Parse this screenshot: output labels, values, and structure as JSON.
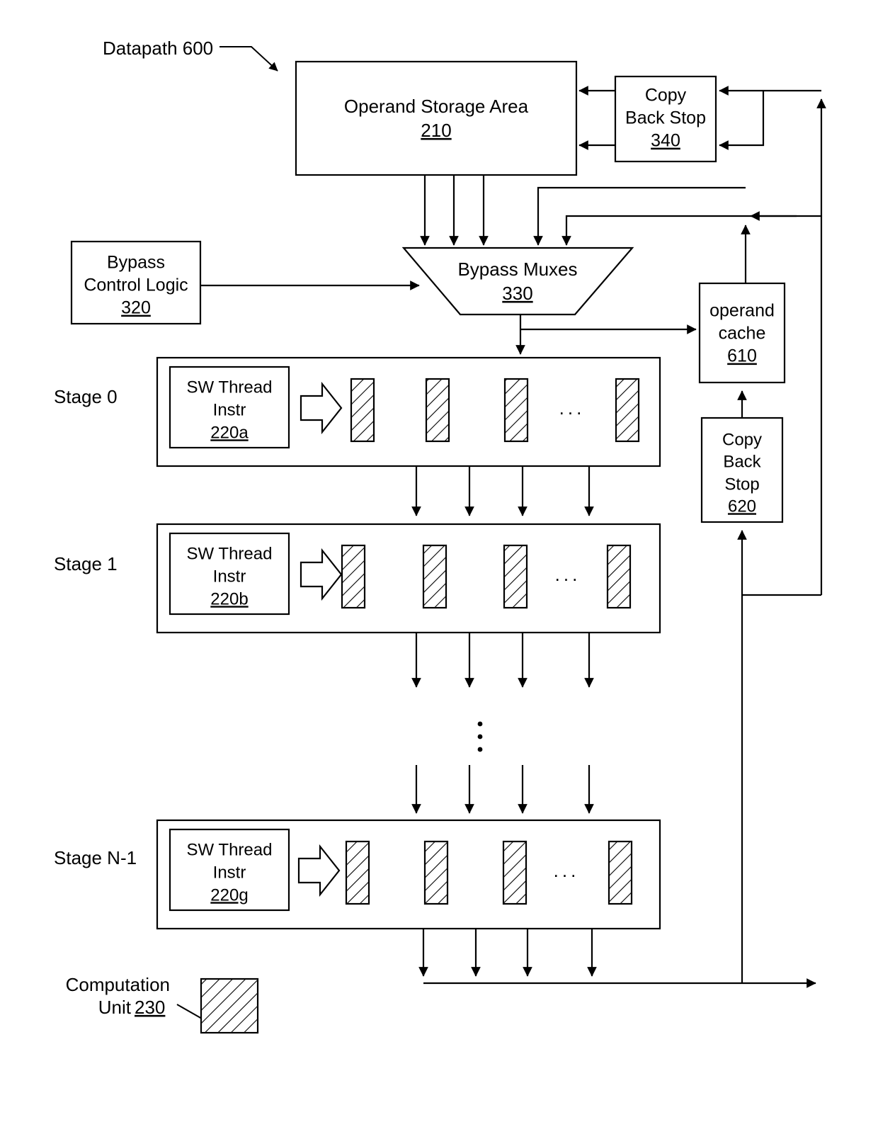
{
  "figure": {
    "title_label": "Datapath 600",
    "legend": {
      "line1": "Computation",
      "line2": "Unit",
      "number": "230"
    }
  },
  "blocks": {
    "operand_storage": {
      "label": "Operand Storage Area",
      "number": "210"
    },
    "copy_back_stop_340": {
      "line1": "Copy",
      "line2": "Back Stop",
      "number": "340"
    },
    "bypass_control_logic": {
      "line1": "Bypass",
      "line2": "Control Logic",
      "number": "320"
    },
    "bypass_muxes": {
      "label": "Bypass Muxes",
      "number": "330"
    },
    "operand_cache": {
      "line1": "operand",
      "line2": "cache",
      "number": "610"
    },
    "copy_back_stop_620": {
      "line1": "Copy",
      "line2": "Back",
      "line3": "Stop",
      "number": "620"
    }
  },
  "stages": [
    {
      "name": "Stage 0",
      "instr": {
        "line1": "SW Thread",
        "line2": "Instr",
        "number": "220a"
      },
      "ellipsis": "..."
    },
    {
      "name": "Stage 1",
      "instr": {
        "line1": "SW Thread",
        "line2": "Instr",
        "number": "220b"
      },
      "ellipsis": "..."
    },
    {
      "name": "Stage N-1",
      "instr": {
        "line1": "SW Thread",
        "line2": "Instr",
        "number": "220g"
      },
      "ellipsis": "..."
    }
  ],
  "colors": {
    "line": "#000000",
    "background": "#ffffff"
  }
}
